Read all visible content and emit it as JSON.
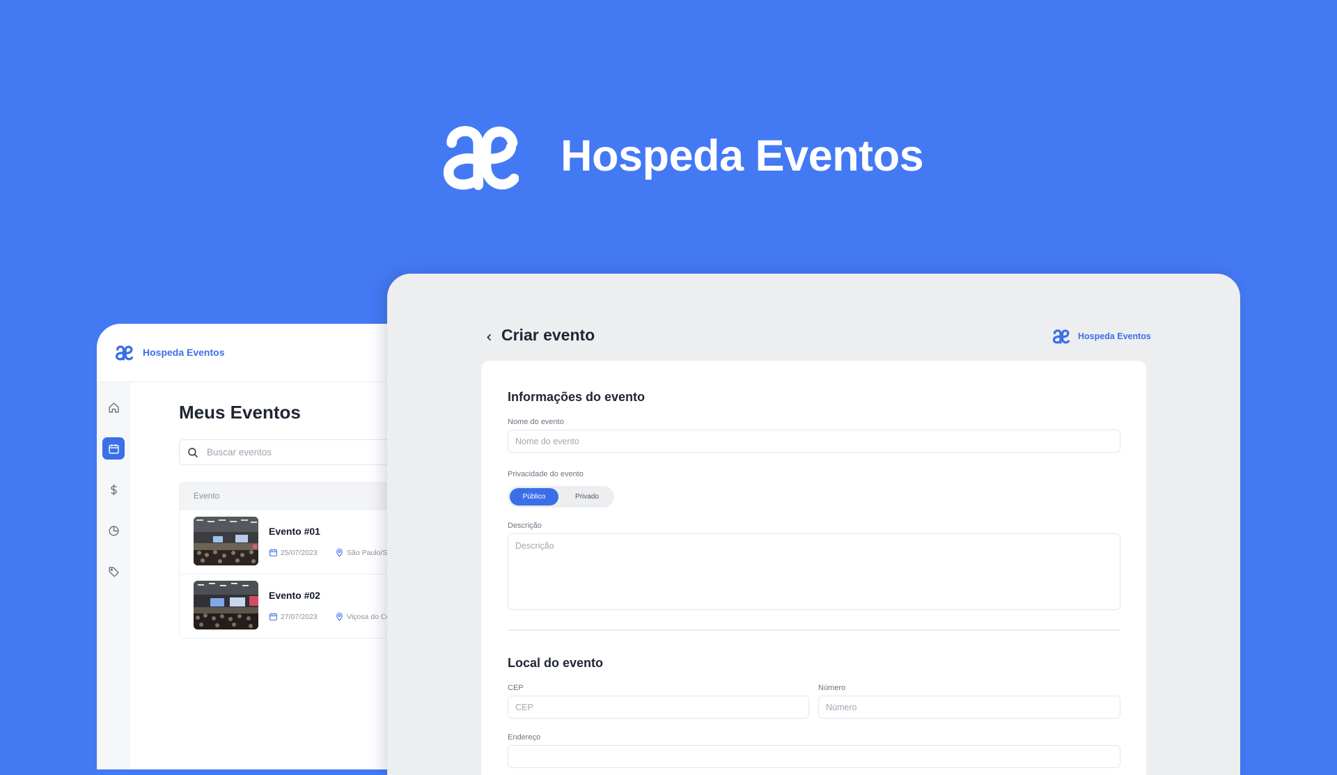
{
  "colors": {
    "background": "#4479F4",
    "accent": "#3B6FE8",
    "white": "#ffffff",
    "panel": "#EDEEF0"
  },
  "hero": {
    "logo_icon": "hospeda-logo-icon",
    "title": "Hospeda Eventos"
  },
  "events_window": {
    "brand_name": "Hospeda Eventos",
    "sidebar": [
      {
        "icon": "home-icon",
        "active": false
      },
      {
        "icon": "calendar-icon",
        "active": true
      },
      {
        "icon": "dollar-icon",
        "active": false
      },
      {
        "icon": "pie-chart-icon",
        "active": false
      },
      {
        "icon": "tag-icon",
        "active": false
      }
    ],
    "page_title": "Meus Eventos",
    "search_placeholder": "Buscar eventos",
    "table_header": "Evento",
    "events": [
      {
        "name": "Evento #01",
        "date": "25/07/2023",
        "location": "São Paulo/S"
      },
      {
        "name": "Evento #02",
        "date": "27/07/2023",
        "location": "Viçosa do Ce"
      }
    ]
  },
  "create_window": {
    "page_title": "Criar evento",
    "brand_name": "Hospeda Eventos",
    "info_section": {
      "title": "Informações do evento",
      "name_label": "Nome do evento",
      "name_placeholder": "Nome do evento",
      "privacy_label": "Privacidade do evento",
      "privacy_options": [
        "Público",
        "Privado"
      ],
      "privacy_selected": "Público",
      "description_label": "Descrição",
      "description_placeholder": "Descrição"
    },
    "location_section": {
      "title": "Local do evento",
      "cep_label": "CEP",
      "cep_placeholder": "CEP",
      "number_label": "Número",
      "number_placeholder": "Número",
      "address_label": "Endereço"
    }
  }
}
